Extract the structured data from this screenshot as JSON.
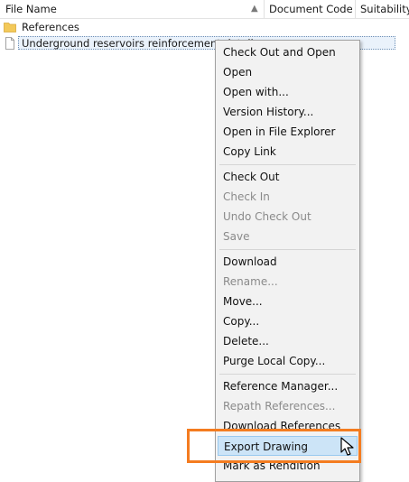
{
  "columns": {
    "file_name": "File Name",
    "document_code": "Document Code",
    "suitability": "Suitability"
  },
  "rows": [
    {
      "icon": "folder-icon",
      "label": "References"
    },
    {
      "icon": "file-icon",
      "label": "Underground reservoirs reinforcement details"
    }
  ],
  "context_menu": {
    "items": [
      {
        "label": "Check Out and Open",
        "enabled": true
      },
      {
        "label": "Open",
        "enabled": true
      },
      {
        "label": "Open with...",
        "enabled": true
      },
      {
        "label": "Version History...",
        "enabled": true
      },
      {
        "label": "Open in File Explorer",
        "enabled": true
      },
      {
        "label": "Copy Link",
        "enabled": true
      },
      {
        "label": "Check Out",
        "enabled": true
      },
      {
        "label": "Check In",
        "enabled": false
      },
      {
        "label": "Undo Check Out",
        "enabled": false
      },
      {
        "label": "Save",
        "enabled": false
      },
      {
        "label": "Download",
        "enabled": true
      },
      {
        "label": "Rename...",
        "enabled": false
      },
      {
        "label": "Move...",
        "enabled": true
      },
      {
        "label": "Copy...",
        "enabled": true
      },
      {
        "label": "Delete...",
        "enabled": true
      },
      {
        "label": "Purge Local Copy...",
        "enabled": true
      },
      {
        "label": "Reference Manager...",
        "enabled": true
      },
      {
        "label": "Repath References...",
        "enabled": false
      },
      {
        "label": "Download References",
        "enabled": true
      },
      {
        "label": "Export Drawing",
        "enabled": true,
        "highlighted": true
      },
      {
        "label": "Mark as Rendition",
        "enabled": true
      }
    ]
  },
  "colors": {
    "highlight_box": "#f47c20",
    "menu_hover": "#cce4f7",
    "folder": "#f3c95a"
  }
}
